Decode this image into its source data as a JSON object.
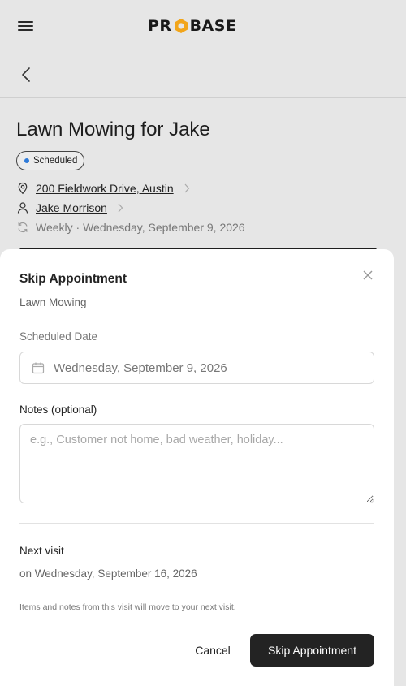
{
  "header": {
    "logo_left": "PR",
    "logo_right": "BASE",
    "brand_color": "#f2a51a"
  },
  "job": {
    "title": "Lawn Mowing for Jake",
    "status": "Scheduled",
    "status_color": "#2f7bd9",
    "address": "200 Fieldwork Drive, Austin",
    "customer": "Jake Morrison",
    "recurrence": "Weekly · Wednesday, September 9, 2026"
  },
  "modal": {
    "title": "Skip Appointment",
    "subtitle": "Lawn Mowing",
    "date_label": "Scheduled Date",
    "date_value": "Wednesday, September 9, 2026",
    "notes_label": "Notes (optional)",
    "notes_placeholder": "e.g., Customer not home, bad weather, holiday...",
    "next_label": "Next visit",
    "next_date": "on Wednesday, September 16, 2026",
    "info_text": "Items and notes from this visit will move to your next visit.",
    "cancel_label": "Cancel",
    "submit_label": "Skip Appointment"
  },
  "icons": [
    "menu-icon",
    "back-arrow-icon",
    "location-pin-icon",
    "person-icon",
    "recurring-icon",
    "chevron-right-icon",
    "close-icon",
    "calendar-icon"
  ]
}
